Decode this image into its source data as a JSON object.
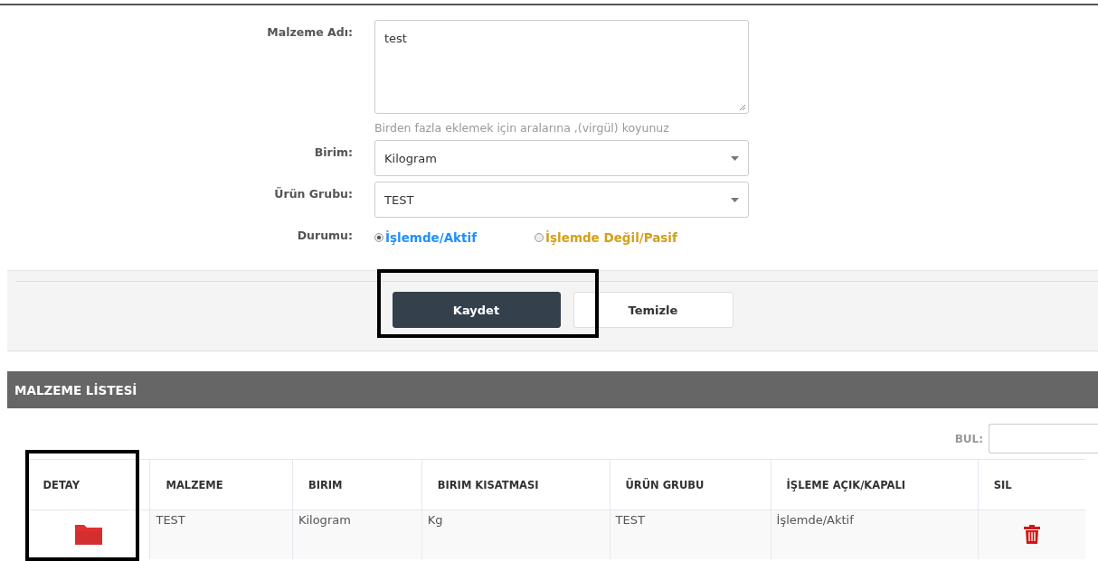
{
  "form": {
    "fields": [
      {
        "kind": "textarea",
        "label": "Malzeme Adı:",
        "value": "test",
        "hint": "Birden fazla eklemek için aralarına ,(virgül) koyunuz"
      },
      {
        "kind": "select",
        "label": "Birim:",
        "value": "Kilogram"
      },
      {
        "kind": "select",
        "label": "Ürün Grubu:",
        "value": "TEST"
      },
      {
        "kind": "radio",
        "label": "Durumu:",
        "options": [
          {
            "label": "İşlemde/Aktif",
            "selected": true,
            "color": "#1e90ff"
          },
          {
            "label": "İşlemde Değil/Pasif",
            "selected": false,
            "color": "#d4a017"
          }
        ]
      }
    ],
    "buttons": [
      {
        "label": "Kaydet",
        "kind": "primary"
      },
      {
        "label": "Temizle",
        "kind": "secondary"
      }
    ]
  },
  "list": {
    "title": "MALZEME LİSTESİ",
    "search_label": "BUL:",
    "columns": [
      "DETAY",
      "MALZEME",
      "BIRIM",
      "BIRIM KISATMASI",
      "ÜRÜN GRUBU",
      "İŞLEME AÇIK/KAPALI",
      "SIL"
    ],
    "rows": [
      {
        "cells": [
          "",
          "TEST",
          "Kilogram",
          "Kg",
          "TEST",
          "İşlemde/Aktif",
          ""
        ]
      }
    ]
  },
  "annotation_frames": [
    {
      "kind": "frame"
    },
    {
      "kind": "frame"
    }
  ]
}
